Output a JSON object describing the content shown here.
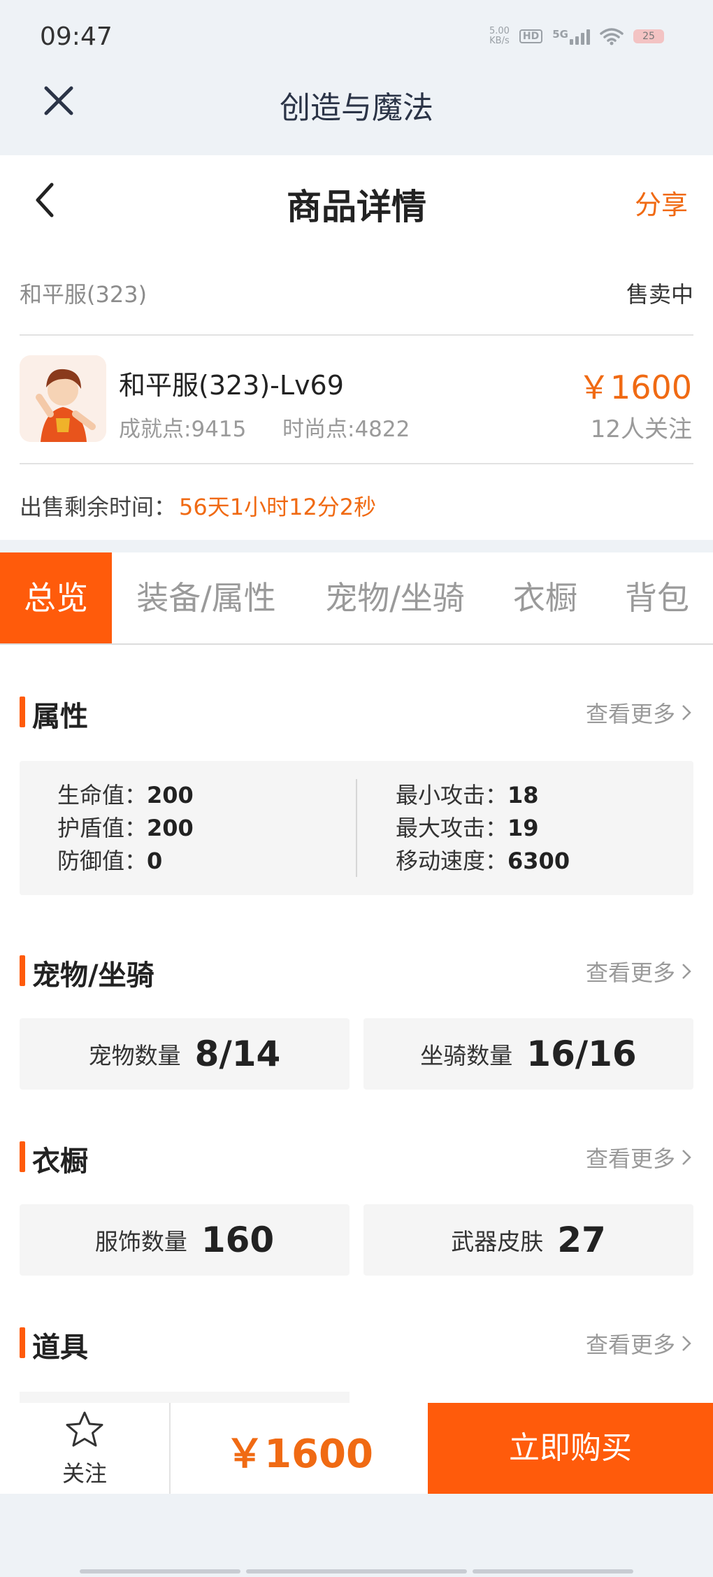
{
  "status_bar": {
    "time": "09:47",
    "net_speed_value": "5.00",
    "net_speed_unit": "KB/s",
    "hd": "HD",
    "network": "5G",
    "battery": "25"
  },
  "mini_app": {
    "title": "创造与魔法",
    "close_icon": "close-icon"
  },
  "header": {
    "title": "商品详情",
    "share_label": "分享",
    "back_icon": "chevron-left-icon"
  },
  "listing": {
    "seller_label": "和平服(323)",
    "status": "售卖中",
    "name": "和平服(323)-Lv69",
    "achievement": "成就点:9415",
    "fashion": "时尚点:4822",
    "price": "￥1600",
    "followers": "12人关注",
    "remaining_label": "出售剩余时间：",
    "remaining_value": "56天1小时12分2秒"
  },
  "tabs": [
    {
      "label": "总览",
      "active": true
    },
    {
      "label": "装备/属性",
      "active": false
    },
    {
      "label": "宠物/坐骑",
      "active": false
    },
    {
      "label": "衣橱",
      "active": false
    },
    {
      "label": "背包",
      "active": false
    }
  ],
  "sections": {
    "attributes": {
      "title": "属性",
      "more": "查看更多",
      "left": [
        {
          "label": "生命值：",
          "value": "200"
        },
        {
          "label": "护盾值：",
          "value": "200"
        },
        {
          "label": "防御值：",
          "value": "0"
        }
      ],
      "right": [
        {
          "label": "最小攻击：",
          "value": "18"
        },
        {
          "label": "最大攻击：",
          "value": "19"
        },
        {
          "label": "移动速度：",
          "value": "6300"
        }
      ]
    },
    "pets": {
      "title": "宠物/坐骑",
      "more": "查看更多",
      "stats": [
        {
          "label": "宠物数量",
          "value": "8/14"
        },
        {
          "label": "坐骑数量",
          "value": "16/16"
        }
      ]
    },
    "wardrobe": {
      "title": "衣橱",
      "more": "查看更多",
      "stats": [
        {
          "label": "服饰数量",
          "value": "160"
        },
        {
          "label": "武器皮肤",
          "value": "27"
        }
      ]
    },
    "items": {
      "title": "道具",
      "more": "查看更多"
    }
  },
  "bottom_bar": {
    "follow_label": "关注",
    "price": "￥1600",
    "buy_label": "立即购买"
  },
  "colors": {
    "accent": "#ff5b0b",
    "price": "#f06a13",
    "page_bg": "#eef2f6"
  }
}
